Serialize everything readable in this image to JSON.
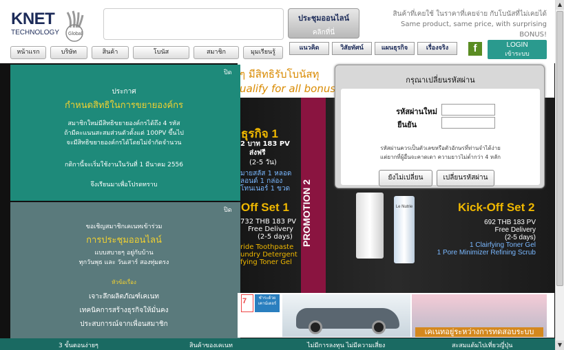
{
  "header": {
    "logo_main": "KNET",
    "logo_sub": "TECHNOLOGY",
    "logo_global": "Global",
    "meeting_title": "ประชุมออนไลน์",
    "meeting_sub": "คลิกที่นี่",
    "tagline_th": "สินค้าที่เคยใช้ ในราคาที่เคยจ่าย กับโบนัสที่ไม่เคยได้",
    "tagline_en": "Same product, same price, with surprising BONUS!",
    "nav": [
      "หน้าแรก",
      "บริษัท",
      "สินค้า",
      "โบนัส",
      "สมาชิก",
      "มุมเรียนรู้"
    ],
    "nav2": [
      "แนวคิด",
      "วิสัยทัศน์",
      "แผนธุรกิจ",
      "เรื่องจริง"
    ],
    "facebook": "f",
    "login_title": "LOGIN",
    "login_sub": "เข้าระบบ"
  },
  "banner": {
    "top_th": "ๆ มีสิทธิรับโบนัสทุ",
    "top_en": "ualify for all bonuses",
    "promo2": "PROMOTION 2",
    "left_biz_title": "ธุรกิจ 1",
    "left_lines": [
      "2 บาท 183 PV",
      "ส่งฟรี",
      "(2-5 วัน)",
      "มายสลัส 1 หลอด",
      "ลอนด์ 1 กล่อง",
      "โทนเนอร์ 1 ขวด"
    ],
    "koff1_title": "Off Set 1",
    "koff1_lines": [
      "732 THB 183 PV",
      "Free Delivery",
      "(2-5 days)",
      "ride Toothpaste",
      "undry Detergent",
      "fying Toner Gel"
    ],
    "koff2_title": "Kick-Off Set 2",
    "koff2_lines": [
      "692 THB 183 PV",
      "Free Delivery",
      "(2-5 days)",
      "1 Clairfying Toner Gel",
      "1 Pore Minimizer Refining Scrub"
    ],
    "tube2_logo": "Le Nutrie"
  },
  "panel1": {
    "close": "ปิด",
    "heading": "ประกาศ",
    "title": "กำหนดสิทธิในการขยายองค์กร",
    "body": [
      "สมาชิกใหม่มีสิทธิขยายองค์กรได้ถึง 4 รหัส",
      "ถ้ามีคะแนนสะสมส่วนตัวตั้งแต่ 100PV ขึ้นไป",
      "จะมีสิทธิขยายองค์กรได้โดยไม่จำกัดจำนวน"
    ],
    "effective": "กติกานี้จะเริ่มใช้งานในวันที่ 1 มีนาคม 2556",
    "closing": "จึงเรียนมาเพื่อโปรดทราบ"
  },
  "panel2": {
    "close": "ปิด",
    "heading": "ขอเชิญสมาชิกเคเนทเข้าร่วม",
    "title": "การประชุมออนไลน์",
    "body": [
      "แบบสบายๆ อยู่กับบ้าน",
      "ทุกวันพุธ และ วันเสาร์ สองทุ่มตรง"
    ],
    "topics_label": "หัวข้อเรื่อง",
    "topics": [
      "เจาะลึกผลิตภัณฑ์เคเนท",
      "เทคนิคการสร้างธุรกิจให้มั่นคง",
      "ประสบการณ์จากเพื่อนสมาชิก"
    ]
  },
  "modal": {
    "title": "กรุณาเปลี่ยนรหัสผ่าน",
    "new_password_label": "รหัสผ่านใหม่",
    "confirm_label": "ยืนยัน",
    "note_line1": "รหัสผ่านควรเป็นตัวเลขหรือตัวอักษรที่ท่านจำได้ง่าย",
    "note_line2": "แต่ยากที่ผู้อื่นจะคาดเดา ความยาวไม่ต่ำกว่า 4 หลัก",
    "cancel_label": "ยังไม่เปลี่ยน",
    "submit_label": "เปลี่ยนรหัสผ่าน"
  },
  "bottom": {
    "seven_eleven": "7",
    "bank_text": "ชำระด้วย เคาน์เตอร์",
    "geisha_caption": "เคเนทอยู่ระหว่างการทดสอบระบบ",
    "footer_items": [
      "3 ขั้นตอนง่ายๆ",
      "สินค้าของเคเนท",
      "ไม่มีการลงทุน ไม่มีความเสี่ยง",
      "สะสมแต้มไปเที่ยวญี่ปุ่น"
    ]
  },
  "scrollbar": {
    "up": "▲",
    "down": "▼"
  }
}
